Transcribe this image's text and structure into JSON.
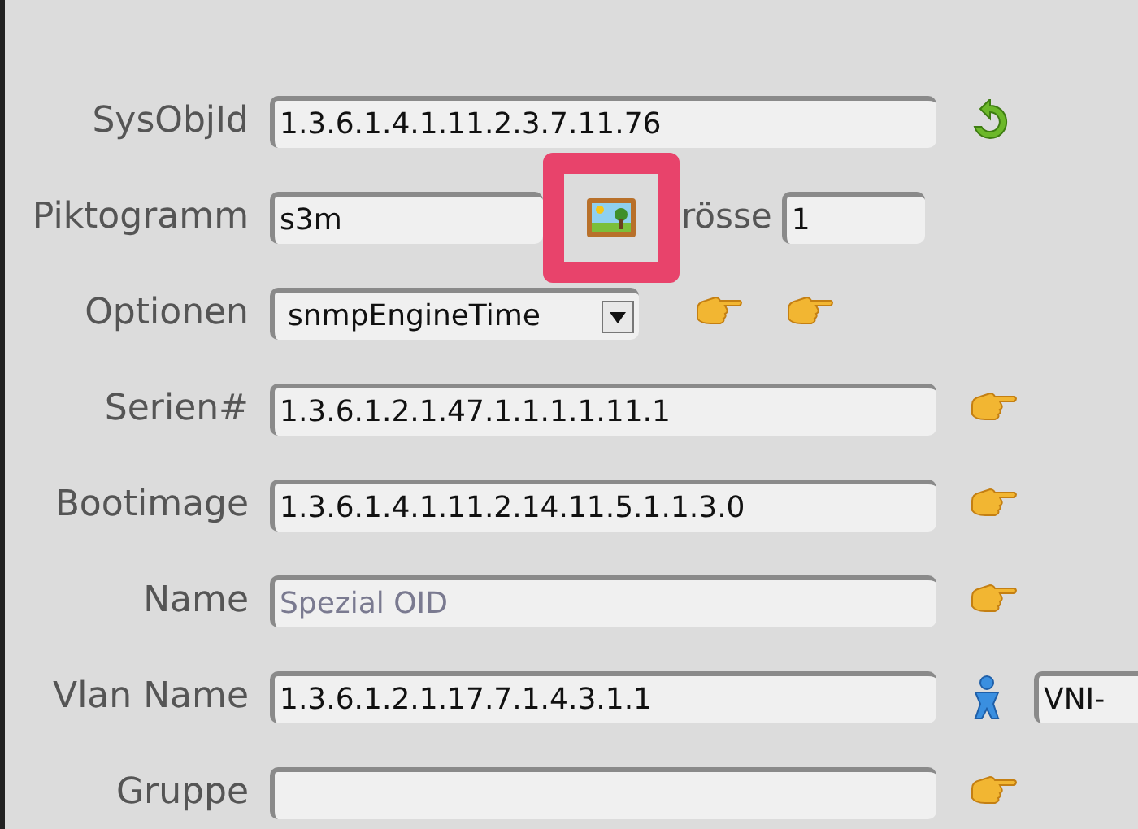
{
  "rows": [
    {
      "kind": "text",
      "label": "SysObjId",
      "value": "1.3.6.1.4.1.11.2.3.7.11.76",
      "actions": [
        {
          "kind": "refresh"
        }
      ]
    },
    {
      "kind": "picto",
      "label": "Piktogramm",
      "value": "s3m",
      "highlighted": true,
      "size_label": "rösse",
      "size_value": "1"
    },
    {
      "kind": "select",
      "label": "Optionen",
      "value": "snmpEngineTime",
      "actions": [
        {
          "kind": "hand"
        },
        {
          "kind": "hand"
        }
      ]
    },
    {
      "kind": "text",
      "label": "Serien#",
      "value": "1.3.6.1.2.1.47.1.1.1.1.11.1",
      "actions": [
        {
          "kind": "hand"
        }
      ]
    },
    {
      "kind": "text",
      "label": "Bootimage",
      "value": "1.3.6.1.4.1.11.2.14.11.5.1.1.3.0",
      "actions": [
        {
          "kind": "hand"
        }
      ]
    },
    {
      "kind": "text",
      "label": "Name",
      "placeholder": "Spezial OID",
      "actions": [
        {
          "kind": "hand"
        }
      ]
    },
    {
      "kind": "text",
      "label": "Vlan Name",
      "value": "1.3.6.1.2.1.17.7.1.4.3.1.1",
      "actions": [
        {
          "kind": "person"
        }
      ],
      "extra_value": "VNI-"
    },
    {
      "kind": "text",
      "label": "Gruppe",
      "value": "",
      "actions": [
        {
          "kind": "hand"
        }
      ]
    }
  ]
}
